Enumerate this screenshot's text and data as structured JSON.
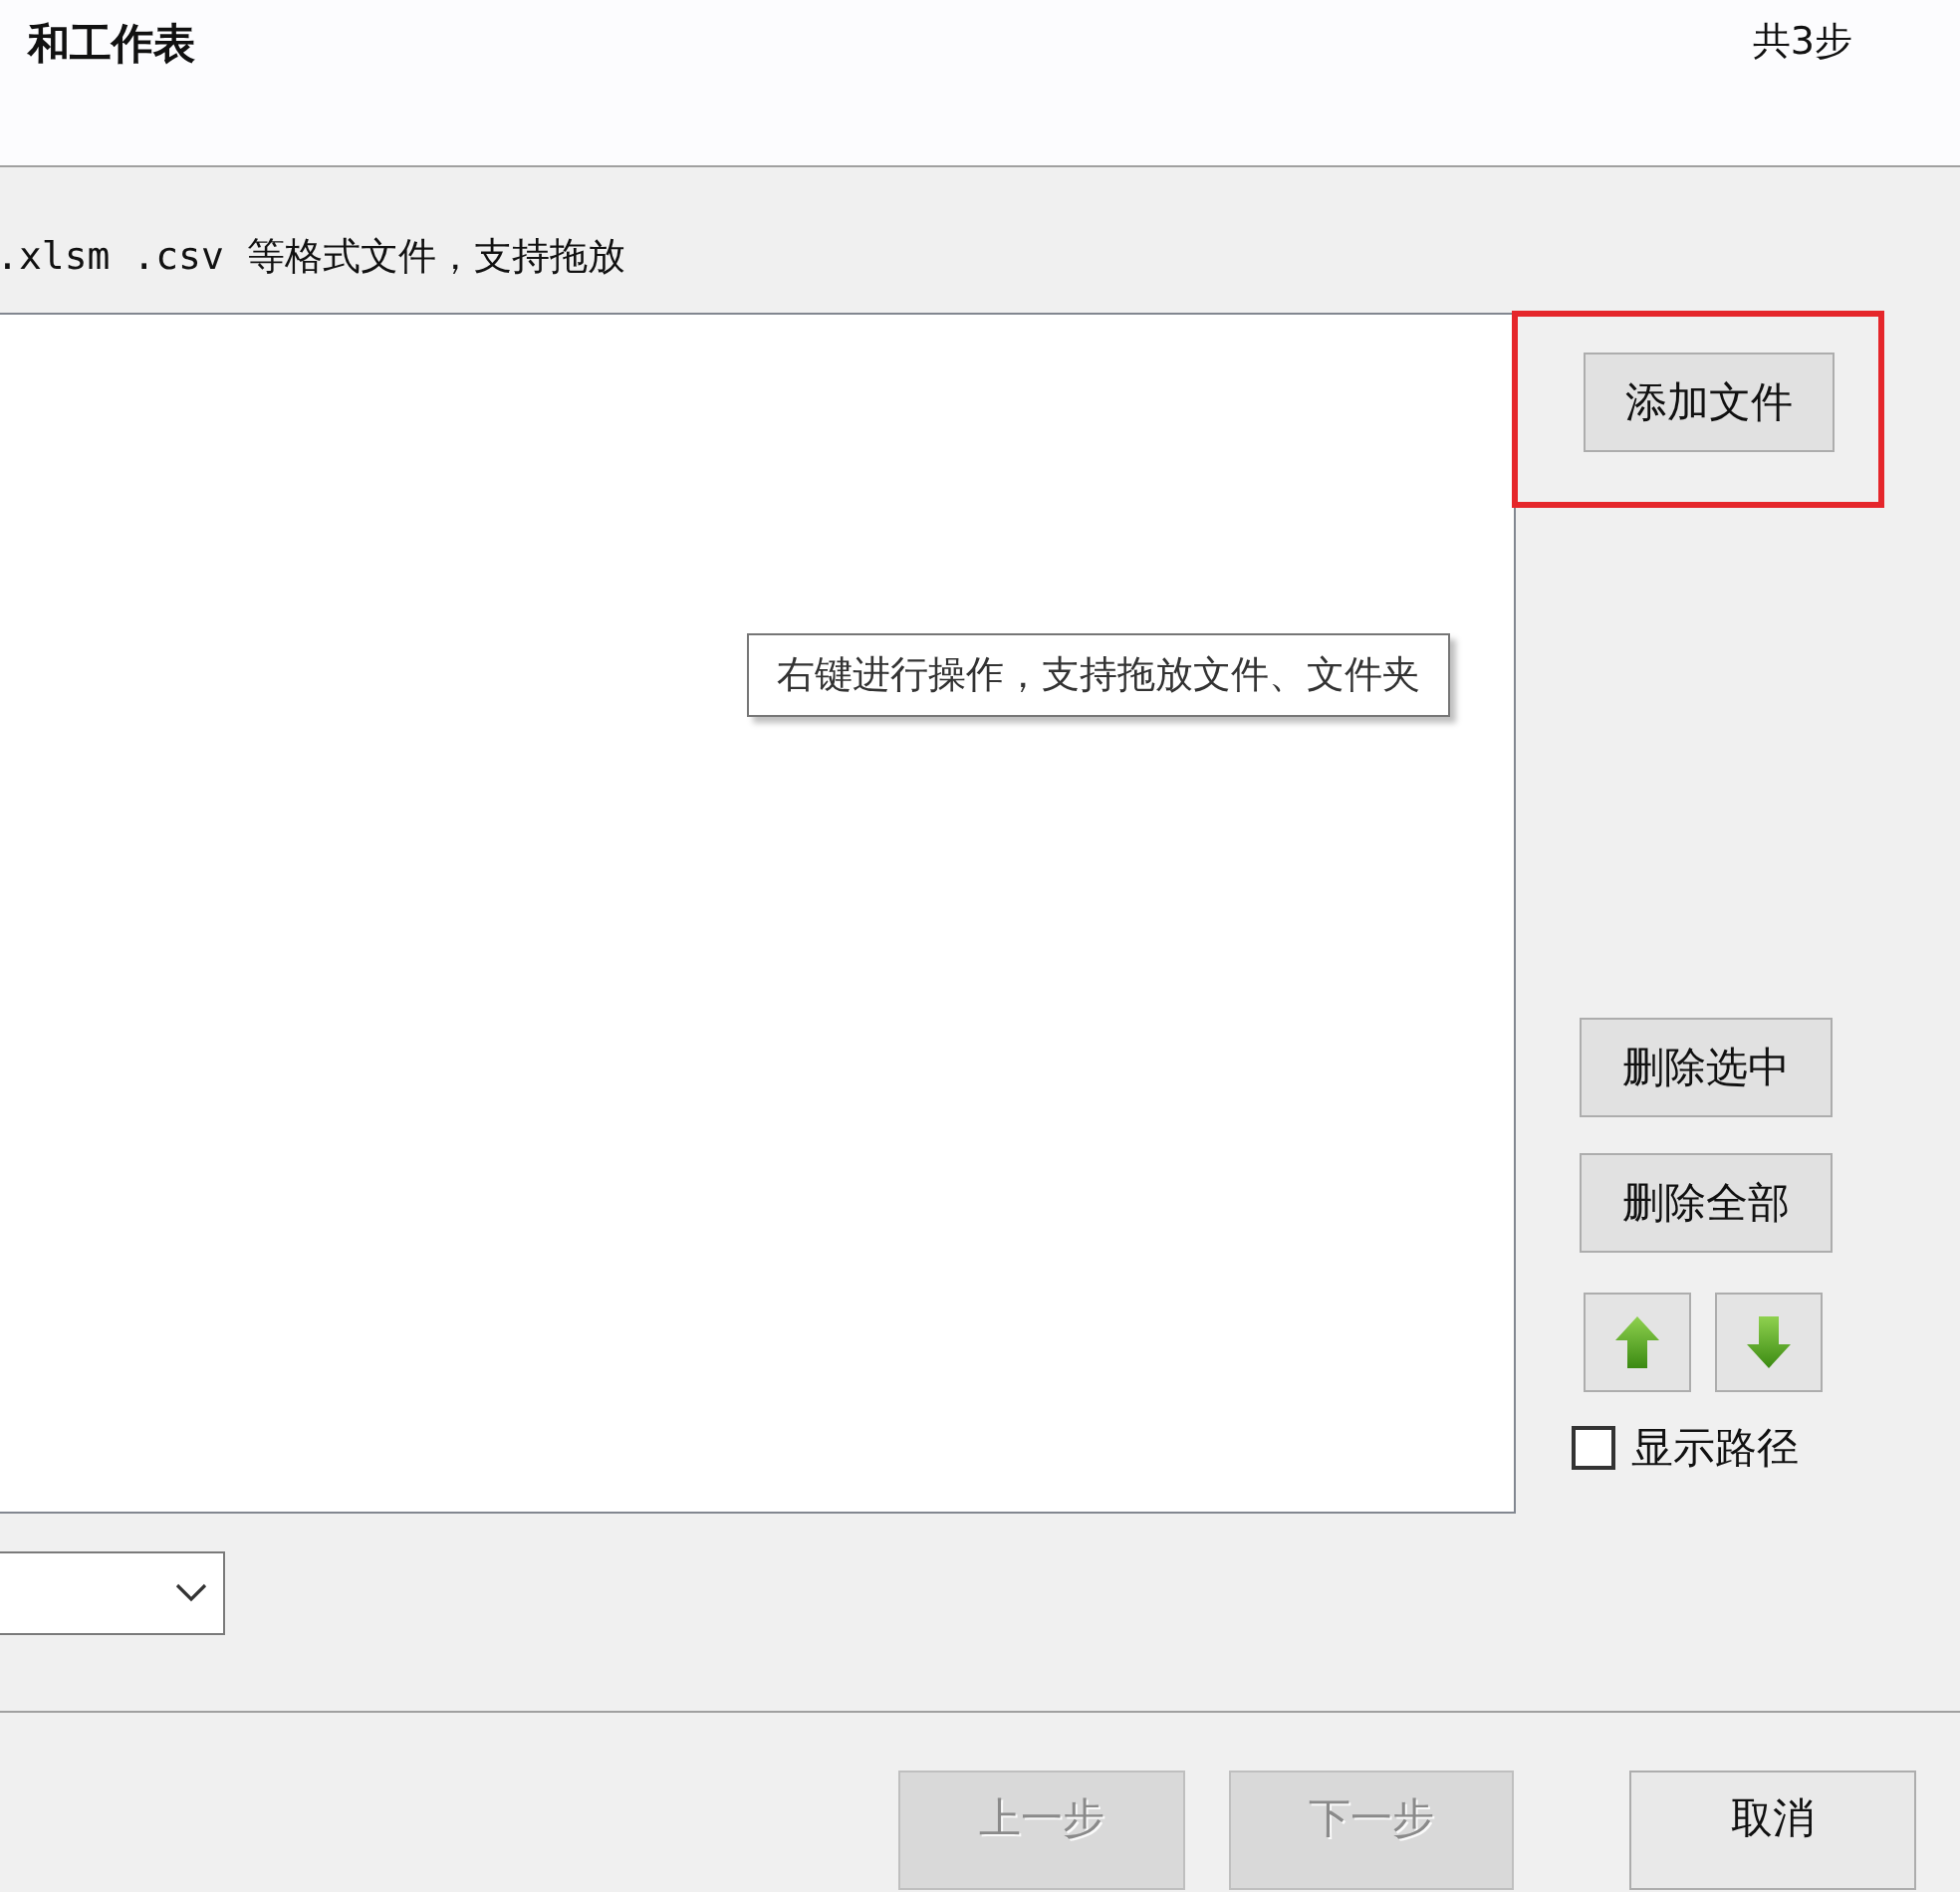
{
  "header": {
    "title": "和工作表",
    "step_count": "共3步"
  },
  "hint": ".xlsm .csv 等格式文件，支持拖放",
  "file_list": {
    "tooltip": "右键进行操作，支持拖放文件、文件夹"
  },
  "side_buttons": [
    {
      "kind": "text",
      "label": "添加文件",
      "highlighted": true
    },
    {
      "kind": "text",
      "label": "删除选中",
      "highlighted": false
    },
    {
      "kind": "text",
      "label": "删除全部",
      "highlighted": false
    },
    {
      "kind": "up"
    },
    {
      "kind": "down"
    }
  ],
  "show_path": {
    "label": "显示路径",
    "checked": false
  },
  "footer_buttons": [
    {
      "label": "上一步",
      "disabled": true
    },
    {
      "label": "下一步",
      "disabled": true
    },
    {
      "label": "取消",
      "disabled": false
    }
  ]
}
